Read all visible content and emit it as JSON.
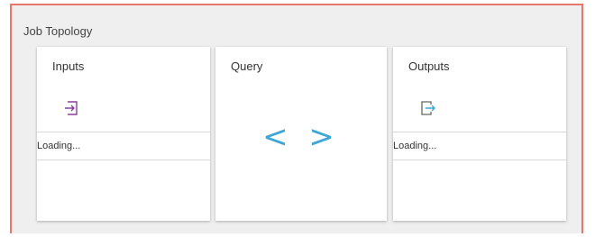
{
  "panel": {
    "title": "Job Topology"
  },
  "tiles": {
    "inputs": {
      "label": "Inputs",
      "icon": "input-icon",
      "status": "Loading..."
    },
    "query": {
      "label": "Query",
      "icon": "code-brackets-icon",
      "glyph": "< >"
    },
    "outputs": {
      "label": "Outputs",
      "icon": "output-icon",
      "status": "Loading..."
    }
  },
  "colors": {
    "border": "#e8766a",
    "accent": "#3fa6d8",
    "icon": "#8a3f9e"
  }
}
